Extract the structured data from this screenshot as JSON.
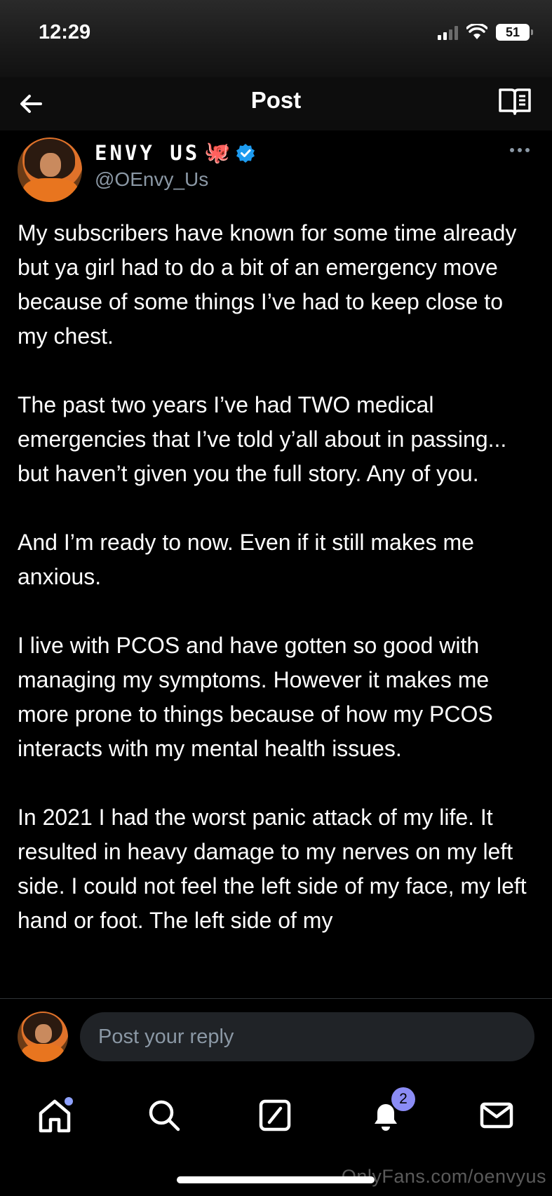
{
  "status_bar": {
    "time": "12:29",
    "battery": "51"
  },
  "header": {
    "title": "Post"
  },
  "post": {
    "author": {
      "display_name": "ENVY US",
      "emoji": "🐙",
      "handle": "@OEnvy_Us"
    },
    "paragraphs": [
      "My subscribers have known for some time already but ya girl had to do a bit of an emergency move because of some things I’ve had to keep close to my chest.",
      "The past two years I’ve had TWO medical emergencies that I’ve told y’all about in passing... but haven’t given you the full story. Any of you.",
      "And I’m ready to now. Even if it still makes me anxious.",
      "I live with PCOS and have gotten so good with managing my symptoms. However it makes me more prone to things because of how my PCOS interacts with my mental health issues.",
      "In 2021 I had the worst panic attack of my life. It resulted in heavy damage to my nerves on my left side. I could not feel the left side of my face, my left hand or foot. The left side of my"
    ]
  },
  "reply": {
    "placeholder": "Post your reply"
  },
  "tab_bar": {
    "items": [
      "home",
      "search",
      "grok",
      "notifications",
      "messages"
    ],
    "notification_count": "2"
  },
  "watermark": "OnlyFans.com/oenvyus",
  "colors": {
    "background": "#000000",
    "accent": "#1d9bf0",
    "muted": "#8b98a5",
    "badge": "#8b8cf5"
  }
}
